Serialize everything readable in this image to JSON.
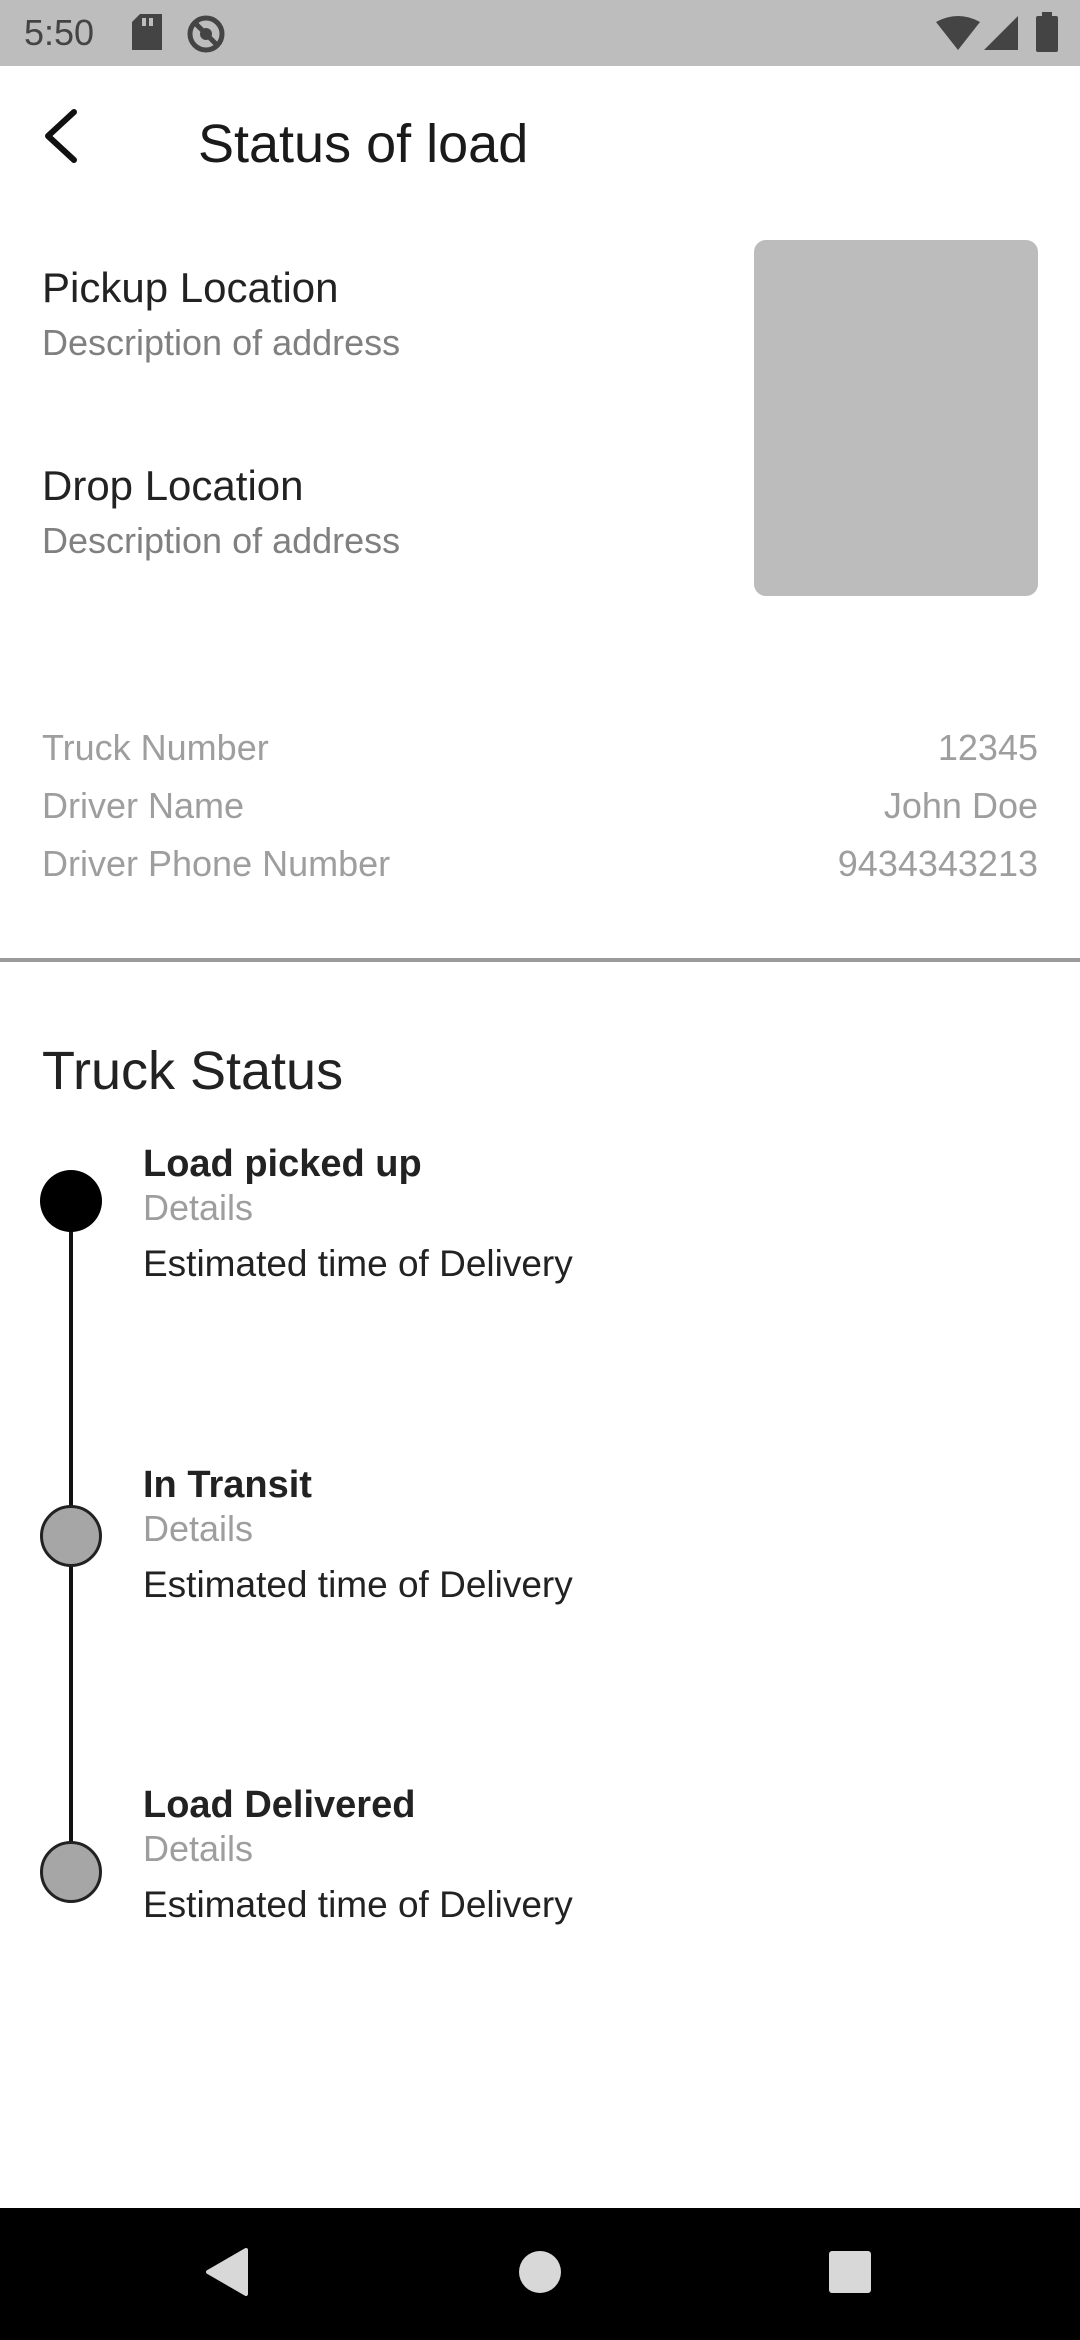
{
  "status_bar": {
    "time": "5:50",
    "icons": [
      "sd-card-icon",
      "no-disturb-icon",
      "wifi-icon",
      "signal-icon",
      "battery-icon"
    ]
  },
  "app_bar": {
    "title": "Status of load",
    "back_icon": "back-arrow-icon"
  },
  "pickup": {
    "title": "Pickup Location",
    "description": "Description of address"
  },
  "drop": {
    "title": "Drop Location",
    "description": "Description of address"
  },
  "info": [
    {
      "label": "Truck Number",
      "value": "12345"
    },
    {
      "label": "Driver Name",
      "value": "John Doe"
    },
    {
      "label": "Driver Phone Number",
      "value": "9434343213"
    }
  ],
  "truck_status": {
    "title": "Truck Status",
    "steps": [
      {
        "title": "Load picked up",
        "details": "Details",
        "eta": "Estimated time of Delivery",
        "state": "active"
      },
      {
        "title": "In Transit",
        "details": "Details",
        "eta": "Estimated time of Delivery",
        "state": "pending"
      },
      {
        "title": "Load Delivered",
        "details": "Details",
        "eta": "Estimated time of Delivery",
        "state": "pending"
      }
    ]
  },
  "nav_bar": {
    "icons": [
      "nav-back-icon",
      "nav-home-icon",
      "nav-recents-icon"
    ]
  },
  "colors": {
    "status_bar_bg": "#bdbdbd",
    "map_placeholder": "#bcbcbc",
    "active_dot": "#000000",
    "pending_dot": "#a6a6a6"
  }
}
